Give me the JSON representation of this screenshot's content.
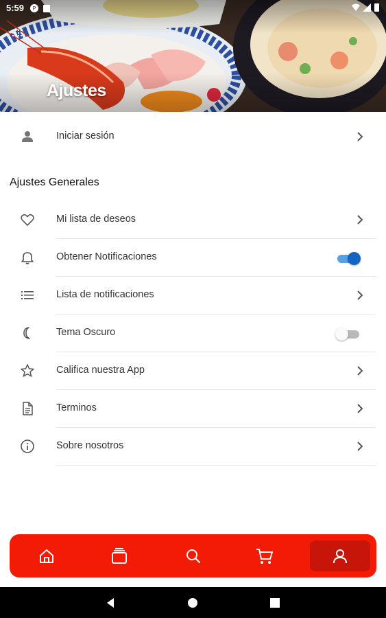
{
  "status_bar": {
    "time": "5:59"
  },
  "header": {
    "title": "Ajustes"
  },
  "login": {
    "label": "Iniciar sesión"
  },
  "section": {
    "title": "Ajustes Generales"
  },
  "items": [
    {
      "label": "Mi lista de deseos",
      "icon": "heart-icon",
      "control": "chevron"
    },
    {
      "label": "Obtener Notificaciones",
      "icon": "bell-icon",
      "control": "toggle",
      "value": true
    },
    {
      "label": "Lista de notificaciones",
      "icon": "list-icon",
      "control": "chevron"
    },
    {
      "label": "Tema Oscuro",
      "icon": "moon-icon",
      "control": "toggle",
      "value": false
    },
    {
      "label": "Califica nuestra App",
      "icon": "star-icon",
      "control": "chevron"
    },
    {
      "label": "Terminos",
      "icon": "document-icon",
      "control": "chevron"
    },
    {
      "label": "Sobre nosotros",
      "icon": "info-icon",
      "control": "chevron"
    }
  ],
  "bottom_nav": {
    "items": [
      {
        "icon": "home-icon",
        "active": false
      },
      {
        "icon": "categories-icon",
        "active": false
      },
      {
        "icon": "search-icon",
        "active": false
      },
      {
        "icon": "cart-icon",
        "active": false
      },
      {
        "icon": "profile-icon",
        "active": true
      }
    ]
  },
  "colors": {
    "accent": "#f31b05",
    "accent_active": "#c8150a",
    "toggle_on": "#1565c0"
  }
}
